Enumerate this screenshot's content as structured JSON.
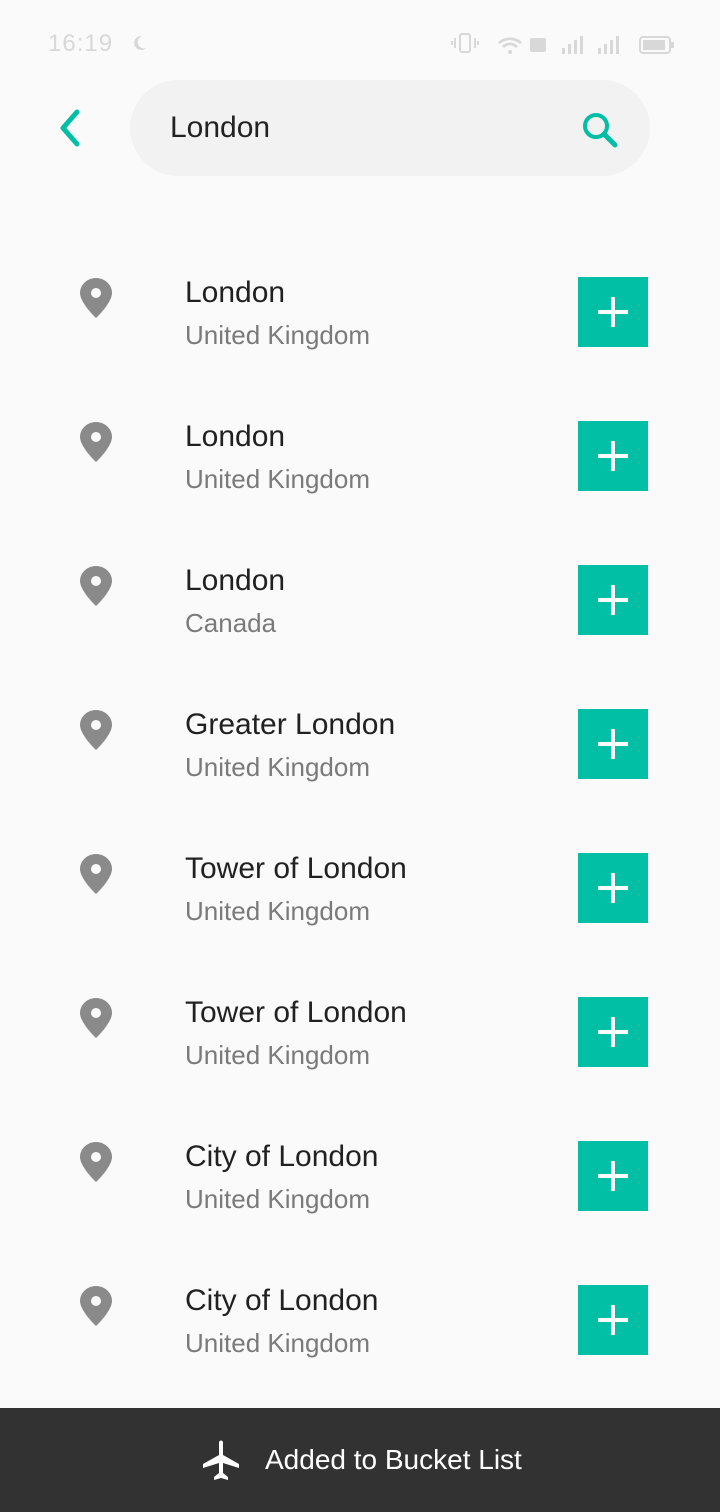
{
  "status_bar": {
    "time": "16:19"
  },
  "search": {
    "value": "London",
    "placeholder": ""
  },
  "results": [
    {
      "name": "London",
      "country": "United Kingdom"
    },
    {
      "name": "London",
      "country": "United Kingdom"
    },
    {
      "name": "London",
      "country": "Canada"
    },
    {
      "name": "Greater London",
      "country": "United Kingdom"
    },
    {
      "name": "Tower of London",
      "country": "United Kingdom"
    },
    {
      "name": "Tower of London",
      "country": "United Kingdom"
    },
    {
      "name": "City of London",
      "country": "United Kingdom"
    },
    {
      "name": "City of London",
      "country": "United Kingdom"
    }
  ],
  "snackbar": {
    "icon": "airplane-icon",
    "message": "Added to Bucket List"
  },
  "colors": {
    "accent": "#00bfa5",
    "pin": "#8a8a8a",
    "snackbar_bg": "#323232"
  }
}
